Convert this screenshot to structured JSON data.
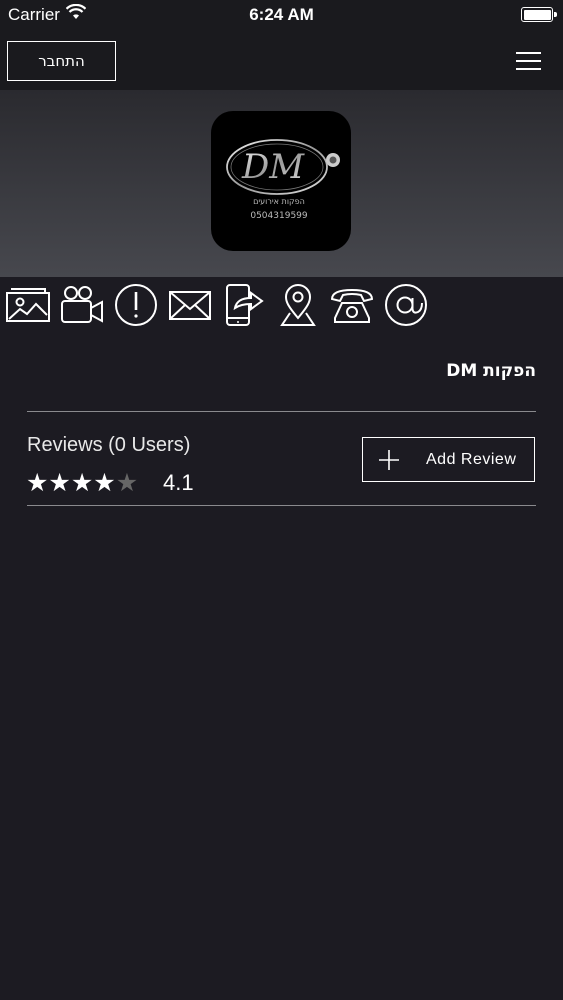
{
  "status_bar": {
    "carrier": "Carrier",
    "time": "6:24 AM",
    "battery_level": 1.0
  },
  "nav": {
    "login_label": "התחבר",
    "menu_icon": "hamburger-menu-icon"
  },
  "logo": {
    "initials": "DM",
    "subtitle": "הפקות אירועים",
    "phone": "0504319599"
  },
  "action_icons": [
    "gallery-icon",
    "video-camera-icon",
    "info-alert-icon",
    "mail-icon",
    "share-phone-icon",
    "location-pin-icon",
    "telephone-icon",
    "at-sign-icon"
  ],
  "business": {
    "name": "הפקות DM"
  },
  "reviews": {
    "title": "Reviews (0 Users)",
    "rating": "4.1",
    "stars_filled": 4,
    "stars_total": 5,
    "add_review_label": "Add Review"
  },
  "colors": {
    "background": "#1c1b22",
    "header_gradient_top": "#2a2a2f",
    "header_gradient_bottom": "#47484e",
    "text": "#ffffff",
    "divider": "#8a8a8e"
  }
}
